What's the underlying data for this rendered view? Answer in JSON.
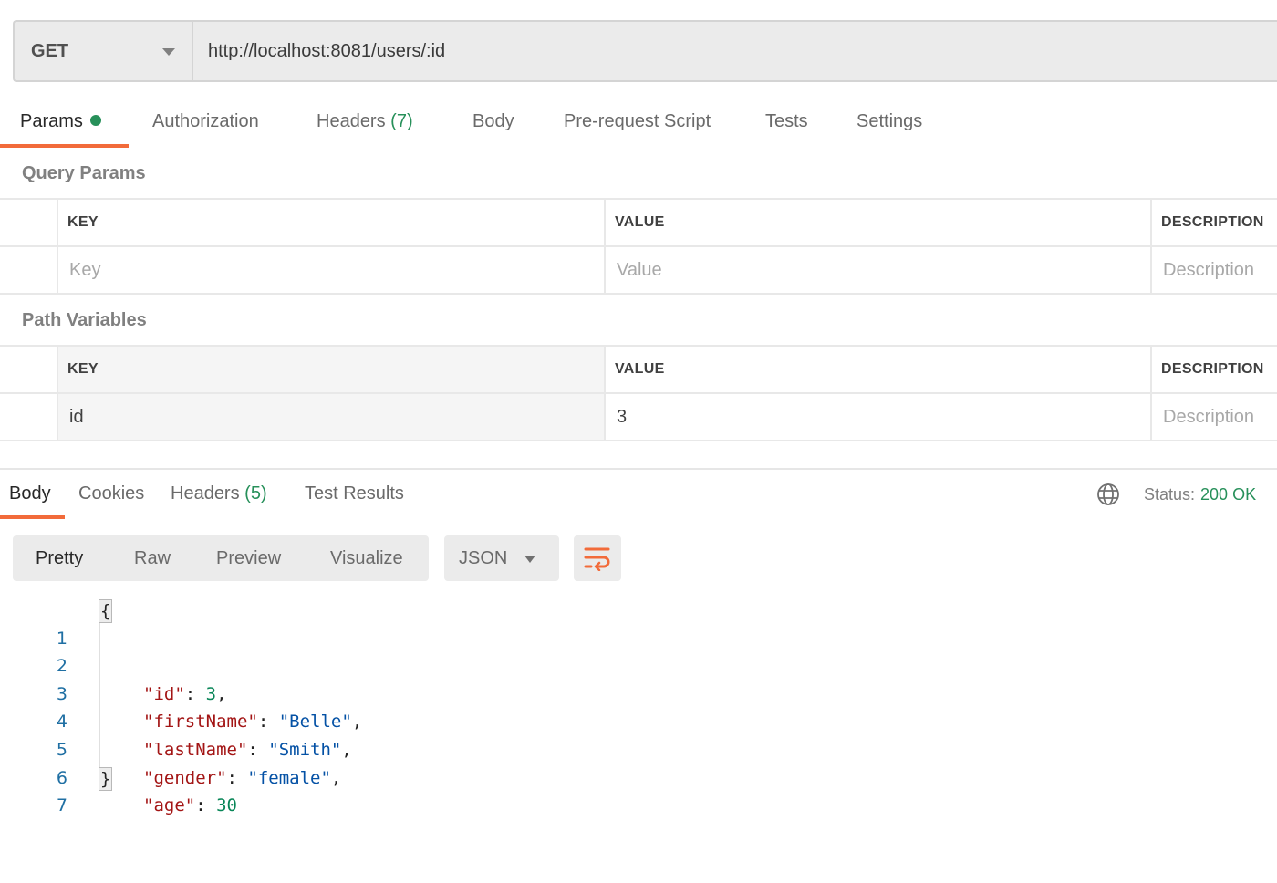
{
  "request": {
    "method": "GET",
    "url": "http://localhost:8081/users/:id"
  },
  "request_tabs": [
    {
      "label": "Params",
      "active": true,
      "has_dot": true
    },
    {
      "label": "Authorization"
    },
    {
      "label": "Headers",
      "count": "(7)"
    },
    {
      "label": "Body"
    },
    {
      "label": "Pre-request Script"
    },
    {
      "label": "Tests"
    },
    {
      "label": "Settings"
    }
  ],
  "query_params": {
    "title": "Query Params",
    "headers": [
      "KEY",
      "VALUE",
      "DESCRIPTION"
    ],
    "placeholders": {
      "key": "Key",
      "value": "Value",
      "description": "Description"
    }
  },
  "path_variables": {
    "title": "Path Variables",
    "headers": [
      "KEY",
      "VALUE",
      "DESCRIPTION"
    ],
    "rows": [
      {
        "key": "id",
        "value": "3",
        "description_placeholder": "Description"
      }
    ]
  },
  "response_tabs": [
    {
      "label": "Body",
      "active": true
    },
    {
      "label": "Cookies"
    },
    {
      "label": "Headers",
      "count": "(5)"
    },
    {
      "label": "Test Results"
    }
  ],
  "status": {
    "label": "Status:",
    "value": "200 OK"
  },
  "view_modes": [
    {
      "label": "Pretty",
      "active": true
    },
    {
      "label": "Raw"
    },
    {
      "label": "Preview"
    },
    {
      "label": "Visualize"
    }
  ],
  "format": "JSON",
  "icons": {
    "globe": "globe-icon",
    "wrap": "word-wrap-icon",
    "method_caret": "chevron-down-icon",
    "format_caret": "chevron-down-icon"
  },
  "colors": {
    "accent": "#f26b3a",
    "success": "#27905a",
    "json_key": "#a31515",
    "json_string": "#0451a5",
    "json_number": "#098658"
  },
  "response_body": {
    "lines": [
      {
        "n": "1",
        "open": "{"
      },
      {
        "n": "2",
        "key": "\"id\"",
        "colon": ": ",
        "value": "3",
        "vtype": "n",
        "comma": ","
      },
      {
        "n": "3",
        "key": "\"firstName\"",
        "colon": ": ",
        "value": "\"Belle\"",
        "vtype": "s",
        "comma": ","
      },
      {
        "n": "4",
        "key": "\"lastName\"",
        "colon": ": ",
        "value": "\"Smith\"",
        "vtype": "s",
        "comma": ","
      },
      {
        "n": "5",
        "key": "\"gender\"",
        "colon": ": ",
        "value": "\"female\"",
        "vtype": "s",
        "comma": ","
      },
      {
        "n": "6",
        "key": "\"age\"",
        "colon": ": ",
        "value": "30",
        "vtype": "n",
        "comma": ""
      },
      {
        "n": "7",
        "close": "}"
      }
    ]
  }
}
